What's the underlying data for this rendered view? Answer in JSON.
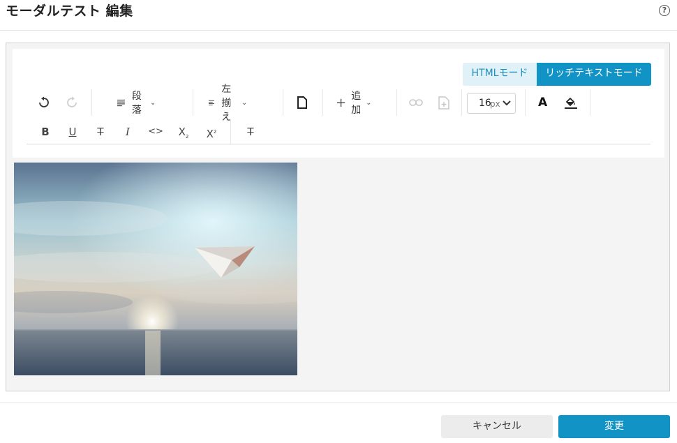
{
  "dialog": {
    "title": "モーダルテスト 編集",
    "help_icon": "question-circle-icon"
  },
  "editor": {
    "modes": {
      "html_label": "HTMLモード",
      "rich_label": "リッチテキストモード",
      "active": "rich"
    },
    "toolbar": {
      "paragraph_label": "段落",
      "align_label": "左揃え",
      "add_label": "追加",
      "font_size_value": "16",
      "font_size_unit": "px"
    },
    "image_description_icon": "paper-plane-over-sea"
  },
  "footer": {
    "cancel_label": "キャンセル",
    "submit_label": "変更"
  },
  "colors": {
    "accent": "#1193c6",
    "accent_light": "#e0f2f8",
    "panel_bg": "#f4f4f4"
  }
}
